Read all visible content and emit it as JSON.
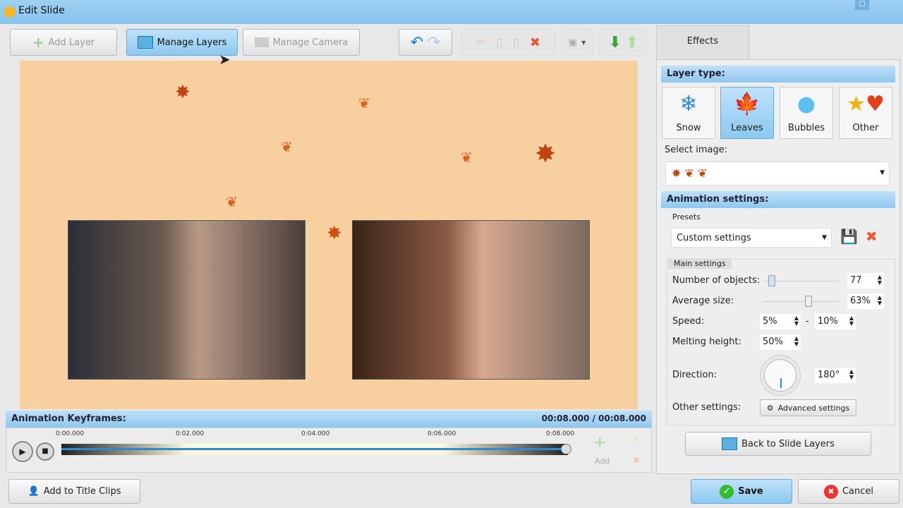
{
  "window": {
    "title": "Edit Slide"
  },
  "toolbar": {
    "add_layer": "Add Layer",
    "manage_layers": "Manage Layers",
    "manage_camera": "Manage Camera"
  },
  "keyframes": {
    "title": "Animation Keyframes:",
    "time": "00:08.000 / 00:08.000",
    "ticks": [
      "0:00.000",
      "0:02.000",
      "0:04.000",
      "0:06.000",
      "0:08.000"
    ],
    "add": "Add",
    "progress": 1.0
  },
  "bottom": {
    "add_to_title_clips": "Add to Title Clips",
    "save": "Save",
    "cancel": "Cancel"
  },
  "effects": {
    "tab": "Effects",
    "layer_type_header": "Layer type:",
    "layer_types": [
      {
        "label": "Snow",
        "icon": "snowflake-icon"
      },
      {
        "label": "Leaves",
        "icon": "leaf-icon",
        "selected": true
      },
      {
        "label": "Bubbles",
        "icon": "bubble-icon"
      },
      {
        "label": "Other",
        "icon": "star-heart-icon"
      }
    ],
    "select_image_label": "Select image:",
    "anim_header": "Animation settings:",
    "presets_label": "Presets",
    "preset_value": "Custom settings",
    "main_settings": "Main settings",
    "number_of_objects": {
      "label": "Number of objects:",
      "value": "77"
    },
    "average_size": {
      "label": "Average size:",
      "value": "63%"
    },
    "speed": {
      "label": "Speed:",
      "min": "5%",
      "sep": "-",
      "max": "10%"
    },
    "melting_height": {
      "label": "Melting height:",
      "value": "50%"
    },
    "direction": {
      "label": "Direction:",
      "value": "180°"
    },
    "other_settings": {
      "label": "Other settings:",
      "button": "Advanced settings"
    },
    "back": "Back to Slide Layers"
  },
  "colors": {
    "accent": "#8cc8ef",
    "stage": "#f8cf9f"
  }
}
